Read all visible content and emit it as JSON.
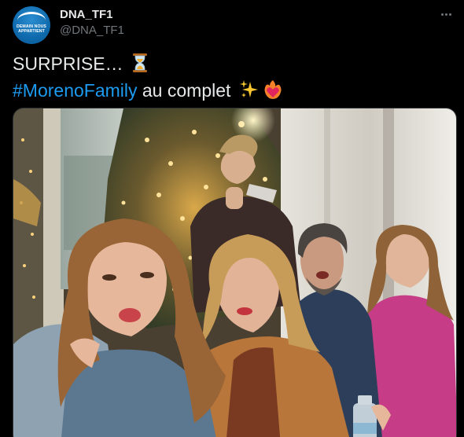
{
  "account": {
    "display_name": "DNA_TF1",
    "handle": "@DNA_TF1",
    "avatar_text": "DEMAIN NOUS APPARTIENT"
  },
  "tweet": {
    "line1_text": "SURPRISE… ",
    "line1_emoji": "hourglass-icon",
    "hashtag": "#MorenoFamily",
    "line2_text": " au complet ",
    "line2_emojis": [
      "sparkles-icon",
      "heart-on-fire-icon"
    ]
  },
  "media": {
    "description_icon": "photo"
  },
  "colors": {
    "background": "#000000",
    "text": "#e7e9ea",
    "muted": "#71767b",
    "link": "#1d9bf0",
    "border": "#2f3336"
  }
}
